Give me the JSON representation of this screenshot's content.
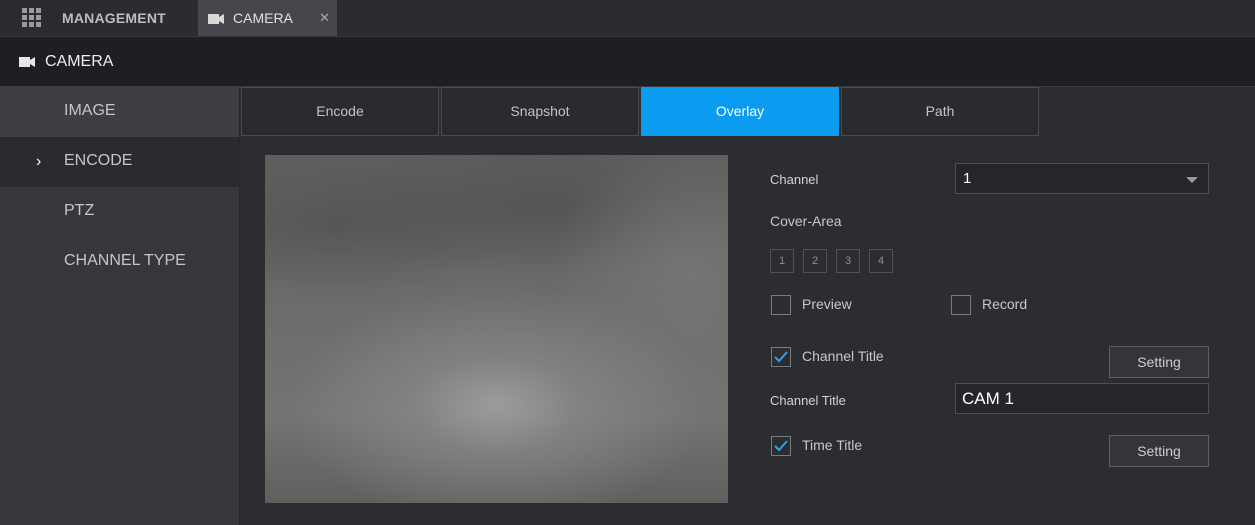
{
  "topbar": {
    "management_label": "MANAGEMENT",
    "tab_label": "CAMERA",
    "close_glyph": "✕",
    "grid_icon": "grid-icon",
    "camera_icon": "video-camera-icon"
  },
  "header": {
    "title": "CAMERA",
    "icon": "video-camera-icon"
  },
  "sidebar": {
    "items": [
      {
        "label": "IMAGE",
        "active": false
      },
      {
        "label": "ENCODE",
        "active": true,
        "chevron": "›"
      },
      {
        "label": "PTZ",
        "active": false
      },
      {
        "label": "CHANNEL TYPE",
        "active": false
      }
    ]
  },
  "tabs": [
    {
      "label": "Encode",
      "active": false
    },
    {
      "label": "Snapshot",
      "active": false
    },
    {
      "label": "Overlay",
      "active": true
    },
    {
      "label": "Path",
      "active": false
    }
  ],
  "form": {
    "channel_label": "Channel",
    "channel_value": "1",
    "cover_area_label": "Cover-Area",
    "cover_areas": [
      "1",
      "2",
      "3",
      "4"
    ],
    "preview_label": "Preview",
    "preview_checked": false,
    "record_label": "Record",
    "record_checked": false,
    "channel_title_check_label": "Channel Title",
    "channel_title_checked": true,
    "channel_title_setting": "Setting",
    "channel_title_field_label": "Channel Title",
    "channel_title_value": "CAM 1",
    "time_title_label": "Time Title",
    "time_title_checked": true,
    "time_title_setting": "Setting"
  },
  "colors": {
    "accent": "#0b9cf2",
    "check": "#2aa3f0",
    "background": "#2c2d31"
  }
}
